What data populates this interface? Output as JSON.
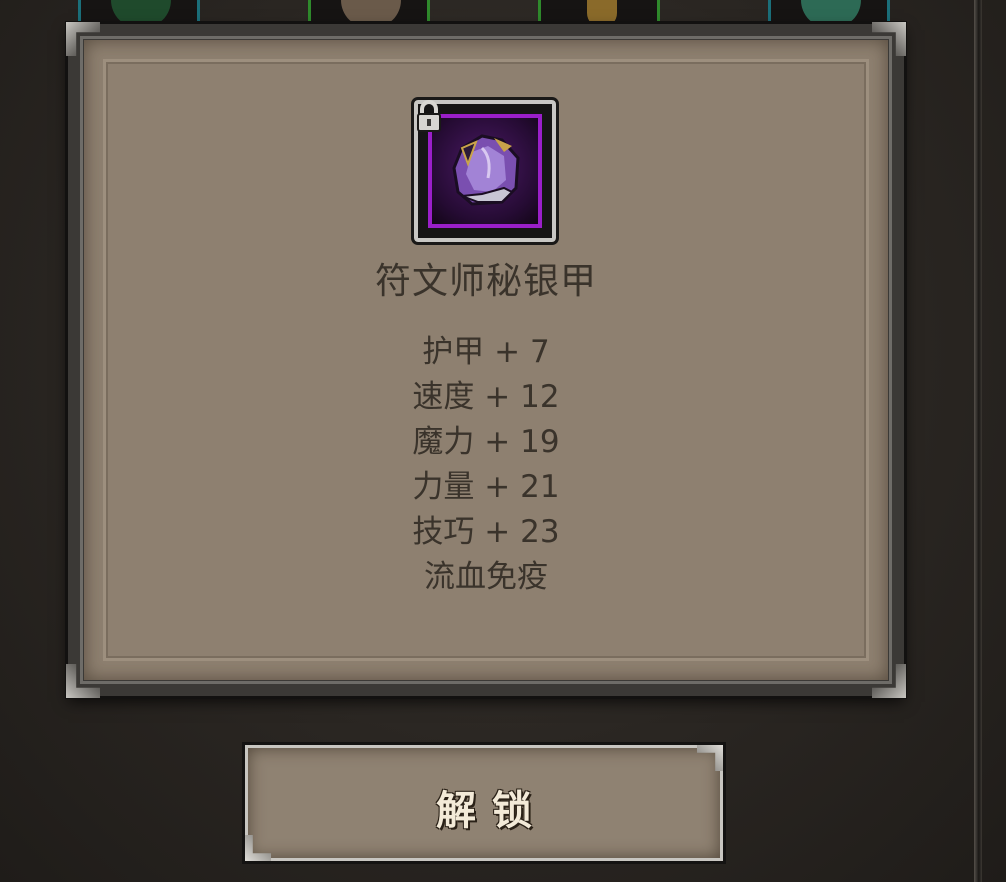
{
  "item": {
    "name": "符文师秘银甲",
    "icon": "purple-armor-icon",
    "locked": true,
    "rarity_color": "#9a1fc9"
  },
  "stats": [
    "护甲 + 7",
    "速度 + 12",
    "魔力 + 19",
    "力量 + 21",
    "技巧 + 23",
    "流血免疫"
  ],
  "unlock_button": {
    "label": "解锁"
  },
  "colors": {
    "panel": "#8e8070",
    "text": "#3a332b",
    "frame": "#3b3936"
  }
}
